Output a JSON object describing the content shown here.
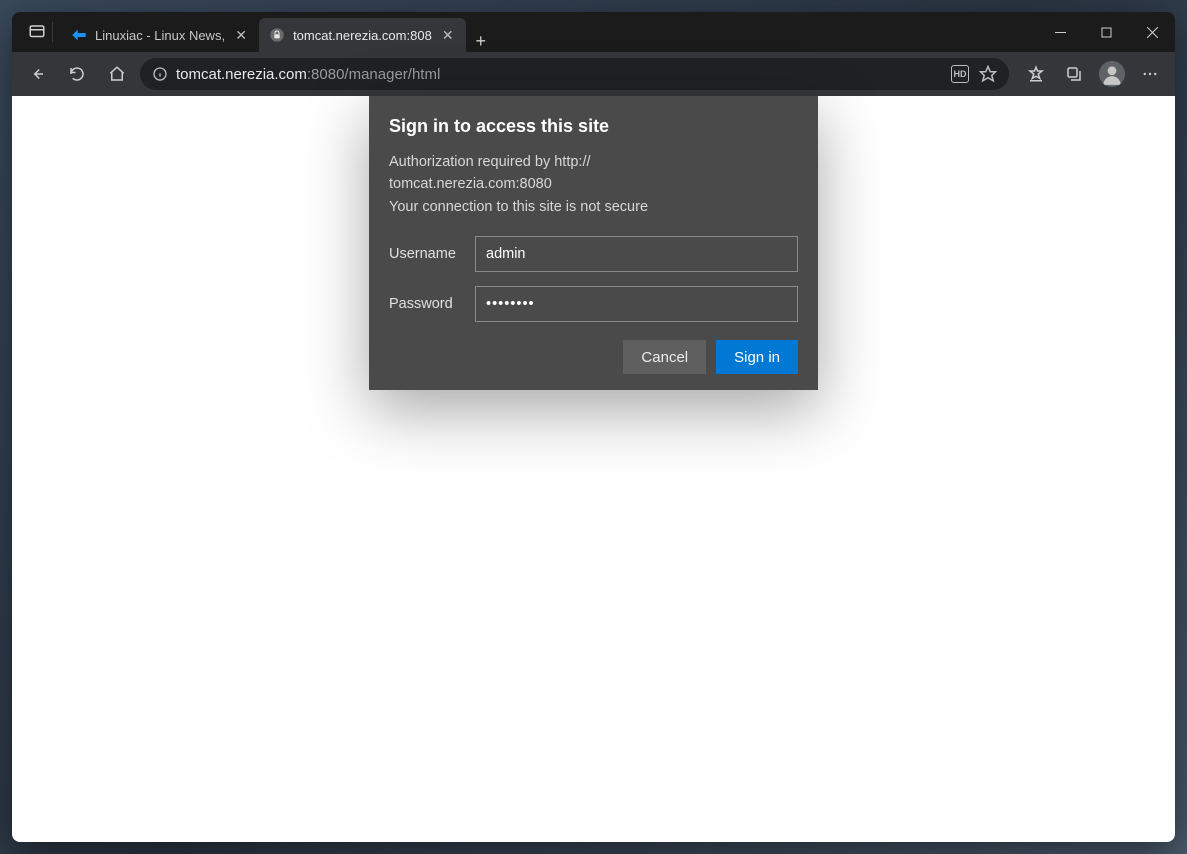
{
  "tabs": [
    {
      "title": "Linuxiac - Linux News,",
      "active": false
    },
    {
      "title": "tomcat.nerezia.com:808",
      "active": true
    }
  ],
  "address": {
    "host": "tomcat.nerezia.com",
    "rest": ":8080/manager/html"
  },
  "auth": {
    "title": "Sign in to access this site",
    "desc_line1": "Authorization required by http://",
    "desc_line2": "tomcat.nerezia.com:8080",
    "desc_line3": "Your connection to this site is not secure",
    "username_label": "Username",
    "password_label": "Password",
    "username_value": "admin",
    "password_value": "••••••••",
    "cancel_label": "Cancel",
    "signin_label": "Sign in"
  }
}
